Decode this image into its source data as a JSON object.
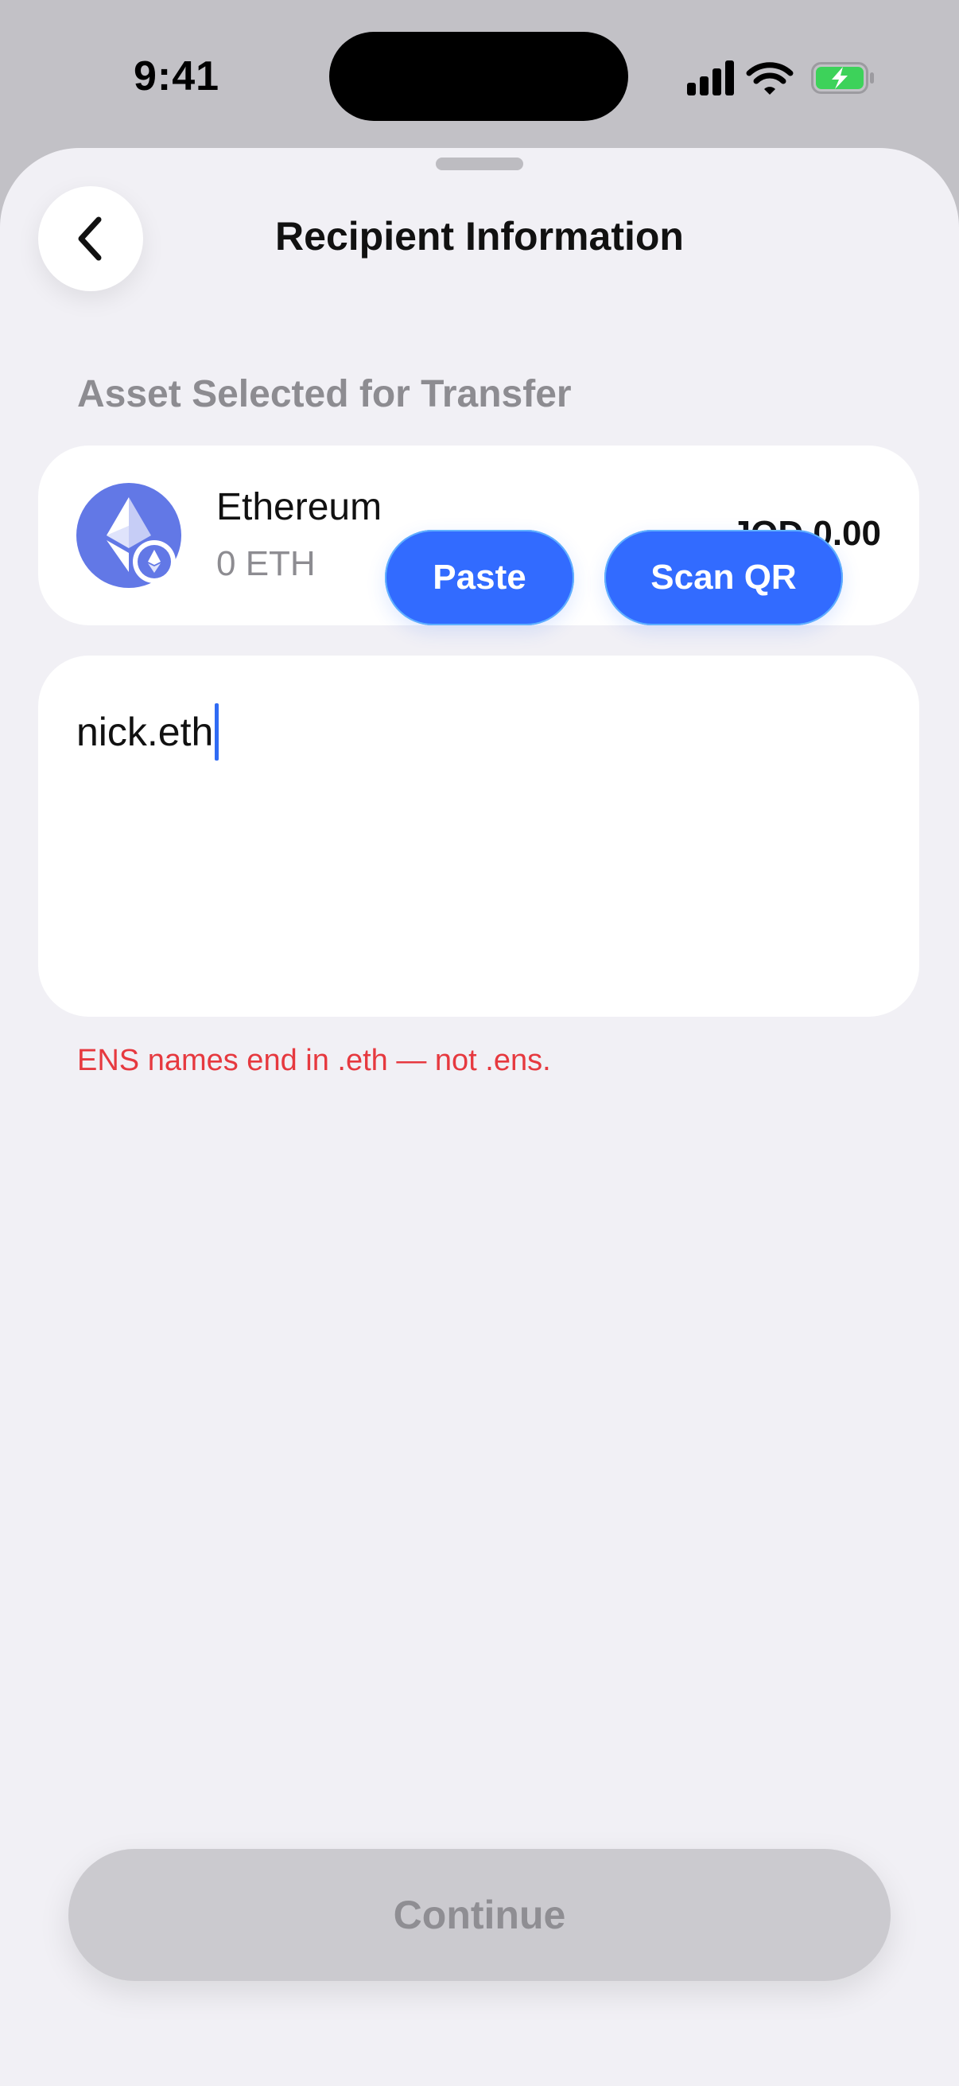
{
  "status_bar": {
    "time": "9:41",
    "icons": [
      "cellular-signal-icon",
      "wifi-icon",
      "battery-charging-icon"
    ]
  },
  "header": {
    "title": "Recipient Information",
    "back_icon": "chevron-left-icon"
  },
  "asset": {
    "section_label": "Asset Selected for Transfer",
    "name": "Ethereum",
    "amount": "0 ETH",
    "fiat_value": "JOD 0.00",
    "logo_icon": "ethereum-logo-icon"
  },
  "recipient": {
    "value": "nick.eth",
    "paste_label": "Paste",
    "scan_label": "Scan QR",
    "error": "ENS names end in .eth — not .ens."
  },
  "footer": {
    "continue_label": "Continue"
  },
  "colors": {
    "accent": "#326bff",
    "error": "#e6393f",
    "battery": "#3dd25a",
    "disabled": "#cbcacf"
  }
}
